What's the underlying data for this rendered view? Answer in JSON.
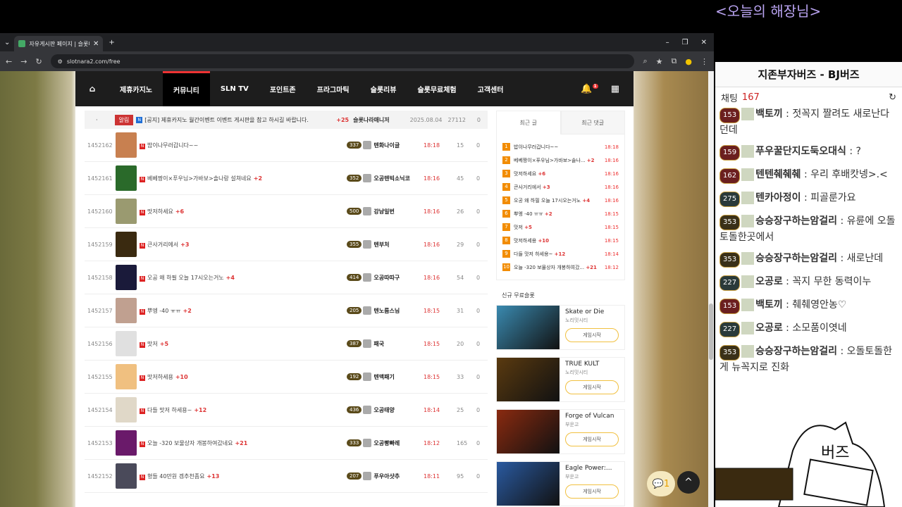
{
  "overlay_title": "<오늘의 해장님>",
  "browser": {
    "tab_title": "자유게시판 페이지 | 슬롯나라",
    "url": "slotnara2.com/free"
  },
  "nav": {
    "items": [
      "제휴카지노",
      "커뮤니티",
      "SLN TV",
      "포인트존",
      "프라그마틱",
      "슬롯리뷰",
      "슬롯무료체험",
      "고객센터"
    ],
    "active": "커뮤니티",
    "bell_count": "1"
  },
  "notice": {
    "badge": "알림",
    "title": "[공지] 제휴카지노 월간이벤트 이벤트 게시판을 참고 하시길 바랍니다.",
    "comments": "+25",
    "author": "슬롯나라매니저",
    "date": "2025.08.04",
    "views": "27112",
    "rec": "0"
  },
  "posts": [
    {
      "num": "1452162",
      "title": "밥이나무러갑니다~~",
      "cnt": "",
      "level": "337",
      "author": "텐화나이글",
      "time": "18:18",
      "views": "15",
      "rec": "0",
      "color": "#c88050"
    },
    {
      "num": "1452161",
      "title": "베베짱이×푸우님>가바보>솔나랑 설쳐네요",
      "cnt": "+2",
      "level": "352",
      "author": "오공텐빅소닉코",
      "time": "18:16",
      "views": "45",
      "rec": "0",
      "color": "#2a6a2a"
    },
    {
      "num": "1452160",
      "title": "맛저하세요",
      "cnt": "+6",
      "level": "500",
      "author": "강남일번",
      "time": "18:16",
      "views": "26",
      "rec": "0",
      "color": "#9a9a70"
    },
    {
      "num": "1452159",
      "title": "큰사거리에서",
      "cnt": "+3",
      "level": "355",
      "author": "텐부처",
      "time": "18:16",
      "views": "29",
      "rec": "0",
      "color": "#3a2a10"
    },
    {
      "num": "1452158",
      "title": "오공 왜 하필 오늘 17시오는거노",
      "cnt": "+4",
      "level": "414",
      "author": "오공따따구",
      "time": "18:16",
      "views": "54",
      "rec": "0",
      "color": "#1a1a3a"
    },
    {
      "num": "1452157",
      "title": "뿌엥 -40 ㅠㅠ",
      "cnt": "+2",
      "level": "205",
      "author": "텐노름스님",
      "time": "18:15",
      "views": "31",
      "rec": "0",
      "color": "#c0a090"
    },
    {
      "num": "1452156",
      "title": "맛저",
      "cnt": "+5",
      "level": "387",
      "author": "패국",
      "time": "18:15",
      "views": "20",
      "rec": "0",
      "color": "#e0e0e0"
    },
    {
      "num": "1452155",
      "title": "맛저하세용",
      "cnt": "+10",
      "level": "192",
      "author": "텐맥패기",
      "time": "18:15",
      "views": "33",
      "rec": "0",
      "color": "#f0c080"
    },
    {
      "num": "1452154",
      "title": "다들 맛저 하세용~",
      "cnt": "+12",
      "level": "436",
      "author": "오공태양",
      "time": "18:14",
      "views": "25",
      "rec": "0",
      "color": "#e0d8c8"
    },
    {
      "num": "1452153",
      "title": "오늘 -320 보물상자 개봉하여갔네요",
      "cnt": "+21",
      "level": "333",
      "author": "오공빵빠레",
      "time": "18:12",
      "views": "165",
      "rec": "0",
      "color": "#6a1a6a"
    },
    {
      "num": "1452152",
      "title": "형들 40만원 겜추천좀요",
      "cnt": "+13",
      "level": "207",
      "author": "푸우아샷추",
      "time": "18:11",
      "views": "95",
      "rec": "0",
      "color": "#4a4a5a"
    }
  ],
  "side": {
    "tab_recent": "최근 글",
    "tab_comments": "최근 댓글",
    "recent": [
      {
        "n": "1",
        "t": "밥이나무러갑니다~~",
        "c": "",
        "time": "18:18"
      },
      {
        "n": "2",
        "t": "베베짱이×푸우님>가바보>솔나...",
        "c": "+2",
        "time": "18:16"
      },
      {
        "n": "3",
        "t": "맛저하세요",
        "c": "+6",
        "time": "18:16"
      },
      {
        "n": "4",
        "t": "큰사거리에서",
        "c": "+3",
        "time": "18:16"
      },
      {
        "n": "5",
        "t": "오공 왜 하필 오늘 17시오는거노",
        "c": "+4",
        "time": "18:16"
      },
      {
        "n": "6",
        "t": "뿌엥 -40 ㅠㅠ",
        "c": "+2",
        "time": "18:15"
      },
      {
        "n": "7",
        "t": "맛저",
        "c": "+5",
        "time": "18:15"
      },
      {
        "n": "8",
        "t": "맛저하세용",
        "c": "+10",
        "time": "18:15"
      },
      {
        "n": "9",
        "t": "다들 맛저 하세용~",
        "c": "+12",
        "time": "18:14"
      },
      {
        "n": "10",
        "t": "오늘 -320 보물상자 개봉하여갔...",
        "c": "+21",
        "time": "18:12"
      }
    ],
    "new_slots_heading": "신규 무료슬롯",
    "games": [
      {
        "name": "Skate or Die",
        "provider": "노리밋시티",
        "btn": "게임시작",
        "color": "#3a8ab0"
      },
      {
        "name": "TRUE KULT",
        "provider": "노리밋시티",
        "btn": "게임시작",
        "color": "#5a3a10"
      },
      {
        "name": "Forge of Vulcan",
        "provider": "부운고",
        "btn": "게임시작",
        "color": "#8a2a10"
      },
      {
        "name": "Eagle Power:...",
        "provider": "부운고",
        "btn": "게임시작",
        "color": "#2a5aa0"
      }
    ]
  },
  "floating": {
    "chat_count": "1",
    "top_label": "^"
  },
  "chat": {
    "title": "지존부자버즈 - BJ버즈",
    "count_label": "채팅",
    "count": "167",
    "messages": [
      {
        "lv": "153",
        "nick": "백토끼",
        "text": "젓꼭지 짤려도 새로난다던데",
        "tone": "red"
      },
      {
        "lv": "159",
        "nick": "푸우꿀단지도둑오대식",
        "text": "?",
        "tone": "red"
      },
      {
        "lv": "162",
        "nick": "텐텐췌췌췌",
        "text": "우리 후배캇넹>.<",
        "tone": "red"
      },
      {
        "lv": "275",
        "nick": "텐카아정이",
        "text": "피골룬가요",
        "tone": "silver"
      },
      {
        "lv": "353",
        "nick": "승승장구하는암걸리",
        "text": "유륜에 오돌토돌한곳에서",
        "tone": "gold"
      },
      {
        "lv": "353",
        "nick": "승승장구하는암걸리",
        "text": "새로난데",
        "tone": "gold"
      },
      {
        "lv": "227",
        "nick": "오공로",
        "text": "꼭지 무한 동력이누",
        "tone": "silver"
      },
      {
        "lv": "153",
        "nick": "백토끼",
        "text": "췌췌영안농♡",
        "tone": "red"
      },
      {
        "lv": "227",
        "nick": "오공로",
        "text": "소모품이엿네",
        "tone": "silver"
      },
      {
        "lv": "353",
        "nick": "승승장구하는암걸리",
        "text": "오돌토돌한게 뉴꼭지로 진화",
        "tone": "gold"
      }
    ],
    "cat_text": "버즈"
  }
}
